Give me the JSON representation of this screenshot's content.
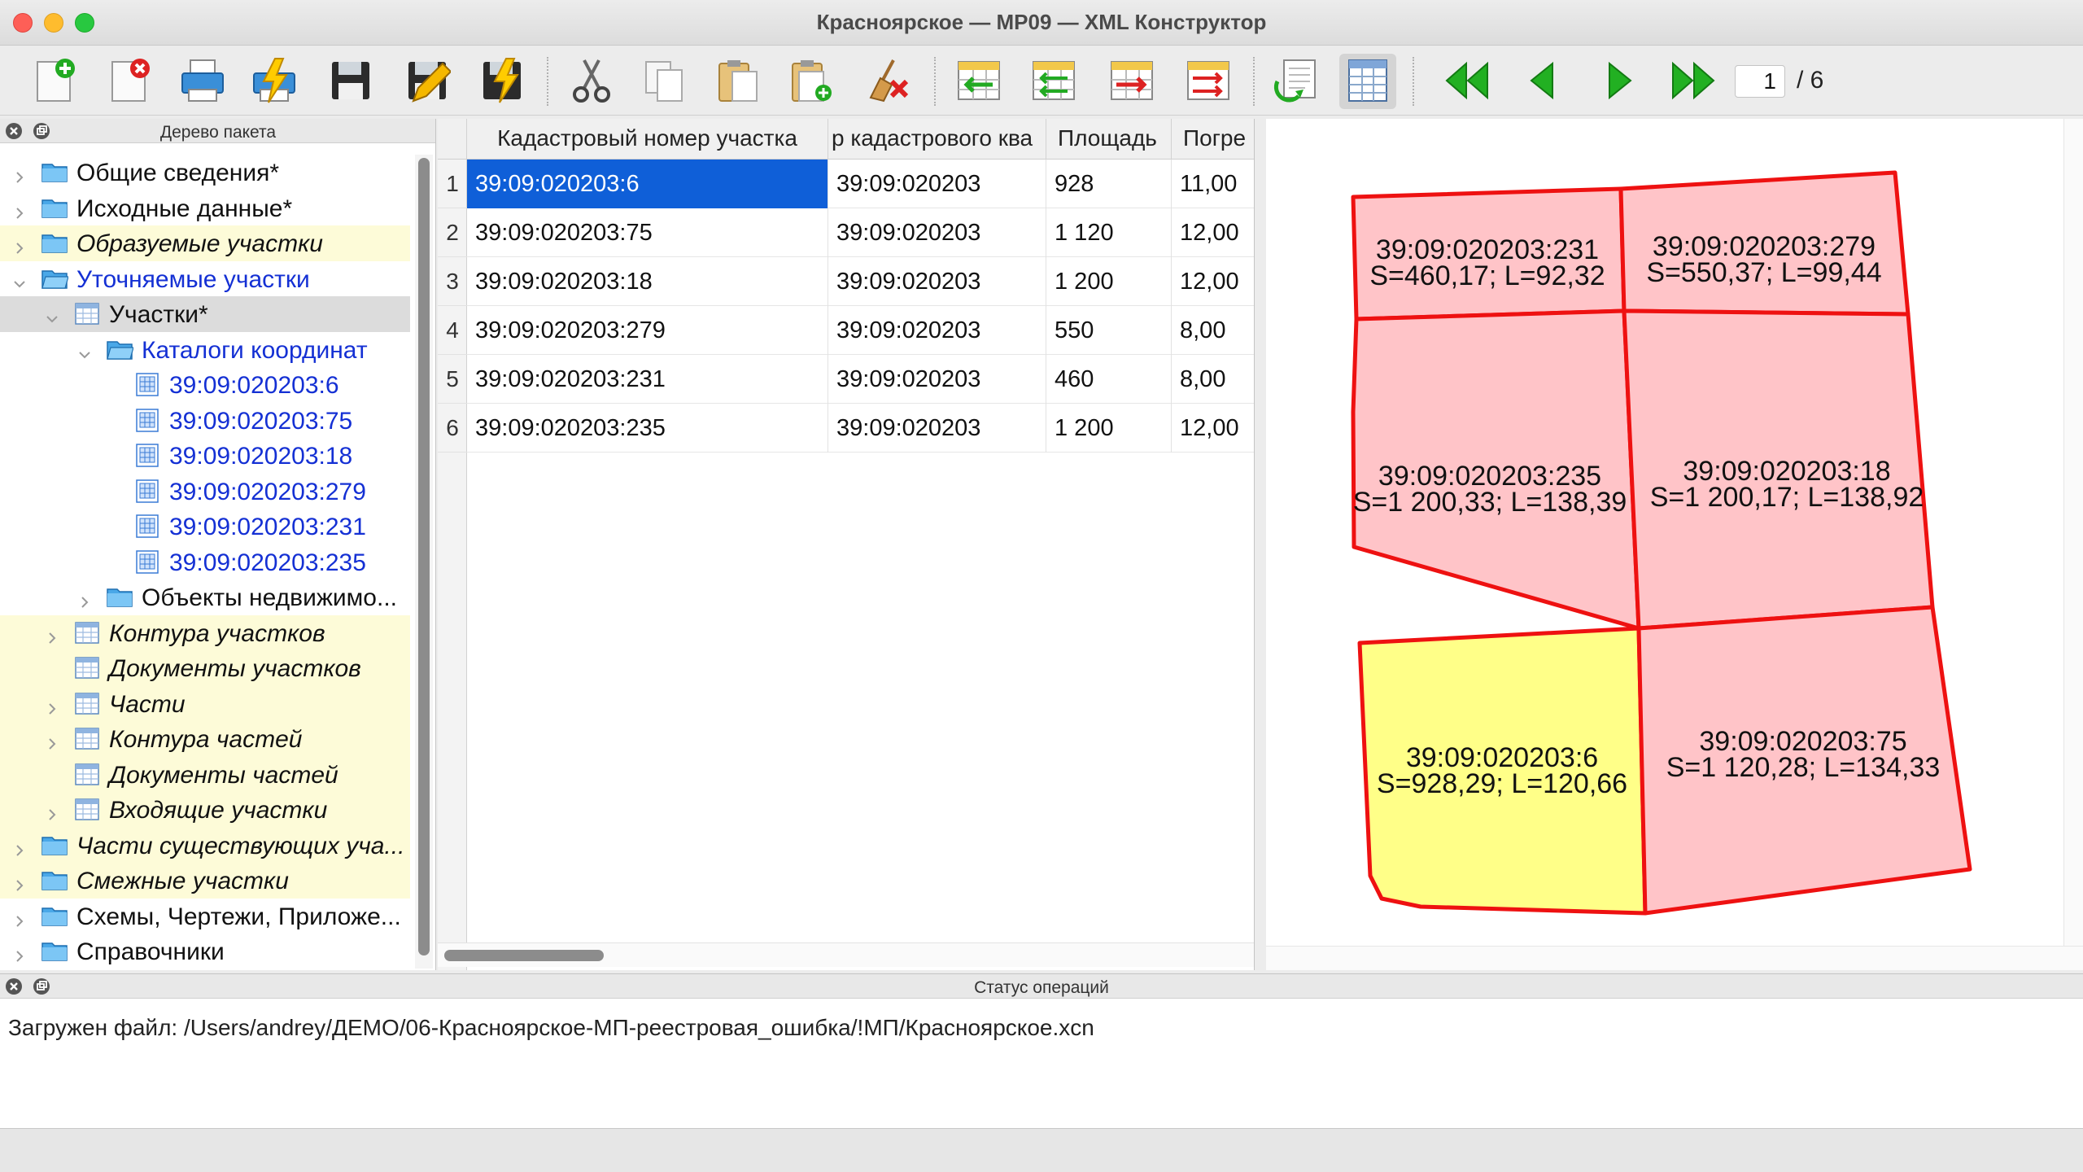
{
  "window": {
    "title": "Красноярское — МР09 — XML Конструктор"
  },
  "toolbar": {
    "buttons": [
      {
        "name": "new-document-button",
        "icon": "document-add-icon"
      },
      {
        "name": "close-document-button",
        "icon": "document-remove-icon"
      },
      {
        "name": "print-button",
        "icon": "printer-icon"
      },
      {
        "name": "print-flash-button",
        "icon": "printer-lightning-icon"
      },
      {
        "name": "save-button",
        "icon": "floppy-disk-icon"
      },
      {
        "name": "save-as-button",
        "icon": "floppy-pen-icon"
      },
      {
        "name": "save-flash-button",
        "icon": "floppy-lightning-icon"
      },
      {
        "name": "cut-button",
        "icon": "scissors-icon"
      },
      {
        "name": "copy-button",
        "icon": "copy-icon"
      },
      {
        "name": "paste-button",
        "icon": "clipboard-icon"
      },
      {
        "name": "paste-add-button",
        "icon": "clipboard-plus-icon"
      },
      {
        "name": "clear-button",
        "icon": "broom-x-icon"
      },
      {
        "name": "table-import-button",
        "icon": "table-arrow-in-icon"
      },
      {
        "name": "table-import-all-button",
        "icon": "table-arrows-in-icon"
      },
      {
        "name": "table-export-button",
        "icon": "table-arrow-out-icon"
      },
      {
        "name": "table-export-all-button",
        "icon": "table-arrows-out-icon"
      },
      {
        "name": "refresh-document-button",
        "icon": "document-refresh-icon"
      },
      {
        "name": "table-view-button",
        "icon": "table-grid-icon"
      },
      {
        "name": "first-page-button",
        "icon": "double-arrow-left-icon"
      },
      {
        "name": "prev-page-button",
        "icon": "arrow-left-icon"
      },
      {
        "name": "next-page-button",
        "icon": "arrow-right-icon"
      },
      {
        "name": "last-page-button",
        "icon": "double-arrow-right-icon"
      }
    ],
    "page_current": "1",
    "page_total": "/ 6"
  },
  "tree_panel": {
    "title": "Дерево пакета",
    "items": [
      {
        "label": "Общие сведения*",
        "level": 0,
        "expander": "collapsed",
        "icon": "folder-icon",
        "style": "normal"
      },
      {
        "label": "Исходные данные*",
        "level": 0,
        "expander": "collapsed",
        "icon": "folder-icon",
        "style": "normal"
      },
      {
        "label": "Образуемые участки",
        "level": 0,
        "expander": "collapsed",
        "icon": "folder-icon",
        "style": "italic-hl"
      },
      {
        "label": "Уточняемые участки",
        "level": 0,
        "expander": "expanded",
        "icon": "folder-open-icon",
        "style": "blue"
      },
      {
        "label": "Участки*",
        "level": 1,
        "expander": "expanded",
        "icon": "table-icon",
        "style": "selected"
      },
      {
        "label": "Каталоги координат",
        "level": 2,
        "expander": "expanded",
        "icon": "folder-open-icon",
        "style": "blue"
      },
      {
        "label": "39:09:020203:6",
        "level": 3,
        "expander": "none",
        "icon": "grid-doc-icon",
        "style": "blue"
      },
      {
        "label": "39:09:020203:75",
        "level": 3,
        "expander": "none",
        "icon": "grid-doc-icon",
        "style": "blue"
      },
      {
        "label": "39:09:020203:18",
        "level": 3,
        "expander": "none",
        "icon": "grid-doc-icon",
        "style": "blue"
      },
      {
        "label": "39:09:020203:279",
        "level": 3,
        "expander": "none",
        "icon": "grid-doc-icon",
        "style": "blue"
      },
      {
        "label": "39:09:020203:231",
        "level": 3,
        "expander": "none",
        "icon": "grid-doc-icon",
        "style": "blue"
      },
      {
        "label": "39:09:020203:235",
        "level": 3,
        "expander": "none",
        "icon": "grid-doc-icon",
        "style": "blue"
      },
      {
        "label": "Объекты недвижимо...",
        "level": 2,
        "expander": "collapsed",
        "icon": "folder-icon",
        "style": "normal"
      },
      {
        "label": "Контура участков",
        "level": 1,
        "expander": "collapsed",
        "icon": "table-icon",
        "style": "italic-hl"
      },
      {
        "label": "Документы участков",
        "level": 1,
        "expander": "none",
        "icon": "table-icon",
        "style": "italic-hl"
      },
      {
        "label": "Части",
        "level": 1,
        "expander": "collapsed",
        "icon": "table-icon",
        "style": "italic-hl"
      },
      {
        "label": "Контура частей",
        "level": 1,
        "expander": "collapsed",
        "icon": "table-icon",
        "style": "italic-hl"
      },
      {
        "label": "Документы частей",
        "level": 1,
        "expander": "none",
        "icon": "table-icon",
        "style": "italic-hl"
      },
      {
        "label": "Входящие участки",
        "level": 1,
        "expander": "collapsed",
        "icon": "table-icon",
        "style": "italic-hl"
      },
      {
        "label": "Части существующих уча...",
        "level": 0,
        "expander": "collapsed",
        "icon": "folder-icon",
        "style": "italic-hl"
      },
      {
        "label": "Смежные участки",
        "level": 0,
        "expander": "collapsed",
        "icon": "folder-icon",
        "style": "italic-hl"
      },
      {
        "label": "Схемы, Чертежи, Приложе...",
        "level": 0,
        "expander": "collapsed",
        "icon": "folder-icon",
        "style": "normal"
      },
      {
        "label": "Справочники",
        "level": 0,
        "expander": "collapsed",
        "icon": "folder-icon",
        "style": "normal"
      }
    ]
  },
  "table": {
    "columns": [
      "Кадастровый номер участка",
      "р кадастрового ква",
      "Площадь",
      "Погре"
    ],
    "rows": [
      {
        "n": "1",
        "cells": [
          "39:09:020203:6",
          "39:09:020203",
          "928",
          "11,00"
        ],
        "selected": true
      },
      {
        "n": "2",
        "cells": [
          "39:09:020203:75",
          "39:09:020203",
          "1 120",
          "12,00"
        ],
        "selected": false
      },
      {
        "n": "3",
        "cells": [
          "39:09:020203:18",
          "39:09:020203",
          "1 200",
          "12,00"
        ],
        "selected": false
      },
      {
        "n": "4",
        "cells": [
          "39:09:020203:279",
          "39:09:020203",
          "550",
          "8,00"
        ],
        "selected": false
      },
      {
        "n": "5",
        "cells": [
          "39:09:020203:231",
          "39:09:020203",
          "460",
          "8,00"
        ],
        "selected": false
      },
      {
        "n": "6",
        "cells": [
          "39:09:020203:235",
          "39:09:020203",
          "1 200",
          "12,00"
        ],
        "selected": false
      }
    ]
  },
  "map": {
    "parcels": [
      {
        "id": "39:09:020203:231",
        "info": "S=460,17; L=92,32",
        "selected": false
      },
      {
        "id": "39:09:020203:279",
        "info": "S=550,37; L=99,44",
        "selected": false
      },
      {
        "id": "39:09:020203:235",
        "info": "S=1 200,33; L=138,39",
        "selected": false
      },
      {
        "id": "39:09:020203:18",
        "info": "S=1 200,17; L=138,92",
        "selected": false
      },
      {
        "id": "39:09:020203:6",
        "info": "S=928,29; L=120,66",
        "selected": true
      },
      {
        "id": "39:09:020203:75",
        "info": "S=1 120,28; L=134,33",
        "selected": false
      }
    ],
    "colors": {
      "fill": "#ffc4c8",
      "stroke": "#ee1111",
      "selected_fill": "#ffff88"
    }
  },
  "status": {
    "title": "Статус операций",
    "message": "Загружен файл: /Users/andrey/ДЕМО/06-Красноярское-МП-реестровая_ошибка/!МП/Красноярское.xcn"
  }
}
